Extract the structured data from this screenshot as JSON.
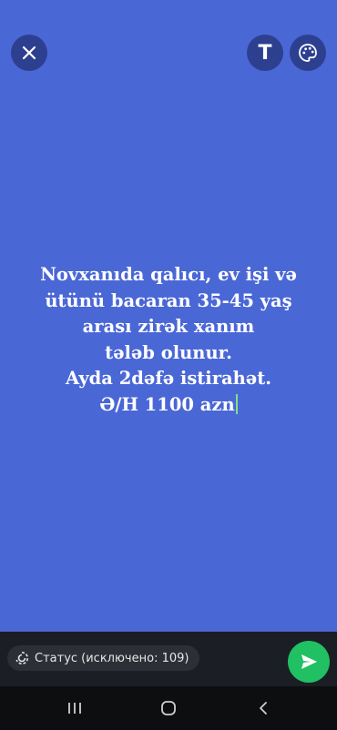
{
  "toolbar": {
    "close_icon": "close-icon",
    "text_label": "T",
    "palette_icon": "palette-icon"
  },
  "status": {
    "lines": [
      "Novxanıda qalıcı, ev işi və",
      "ütünü bacaran 35-45 yaş",
      "arası zirək xanım",
      "tələb olunur.",
      "Ayda 2dəfə istirahət.",
      "Ə/H 1100 azn"
    ],
    "background_color": "#4a67d6"
  },
  "footer": {
    "privacy_label": "Статус (исключено: 109)",
    "send_color": "#21c063"
  },
  "navbar": {
    "recents_icon": "recents-icon",
    "home_icon": "home-icon",
    "back_icon": "back-icon"
  }
}
